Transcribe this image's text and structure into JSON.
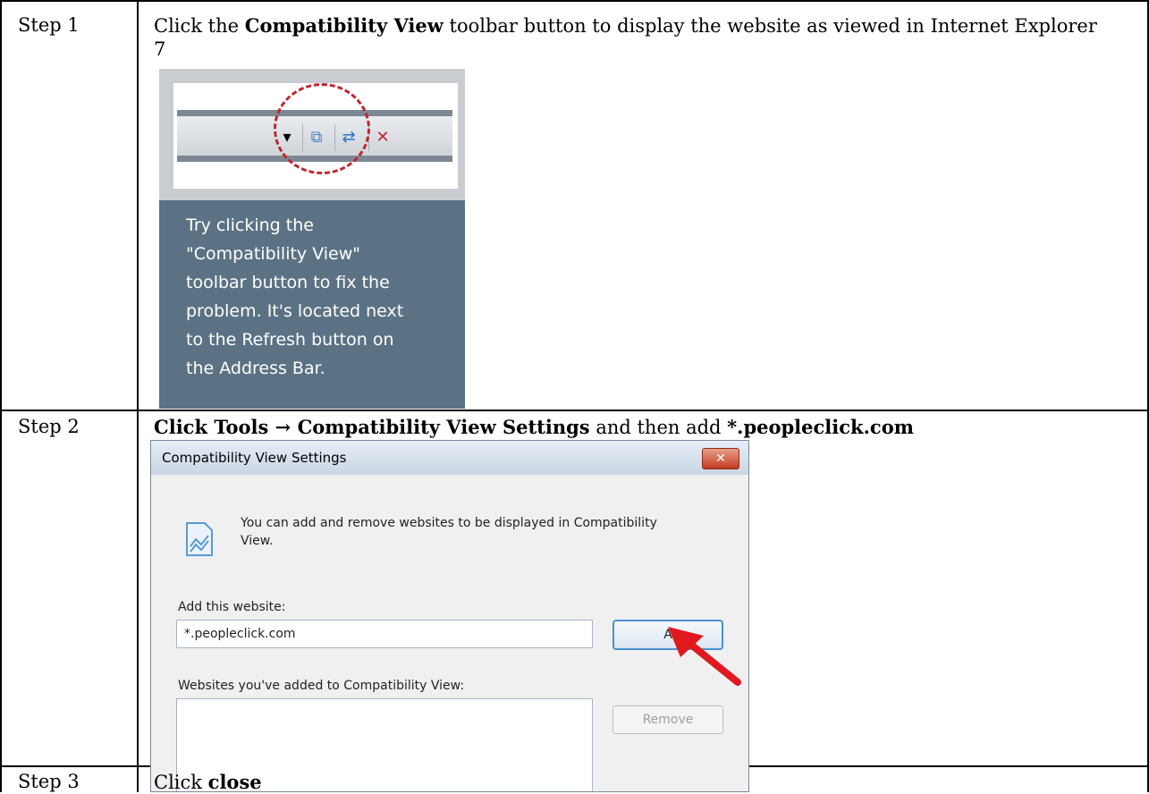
{
  "rows": [
    {
      "label": "Step 1",
      "instr_pre": "Click the ",
      "instr_bold": "Compatibility View",
      "instr_post": " toolbar button to display the website as viewed in Internet Explorer 7"
    },
    {
      "label": "Step 2",
      "instr_bold1": "Click Tools → Compatibility View Settings",
      "instr_mid": " and then add ",
      "instr_bold2": "*.peopleclick.com"
    },
    {
      "label": "Step 3",
      "instr_pre": "Click ",
      "instr_bold": "close"
    }
  ],
  "step1_image": {
    "tip_text": "Try clicking the\n\"Compatibility View\"\ntoolbar button to fix the\nproblem. It's located next\nto the Refresh button on\nthe Address Bar.",
    "icons": [
      "dropdown-arrow-icon",
      "compatibility-view-icon",
      "refresh-icon",
      "stop-icon"
    ],
    "highlight_color": "#c0262d"
  },
  "dialog": {
    "title": "Compatibility View Settings",
    "close_glyph": "✕",
    "description": "You can add and remove websites to be displayed in Compatibility View.",
    "add_label": "Add this website:",
    "add_value": "*.peopleclick.com",
    "add_button": "A",
    "added_label": "Websites you've added to Compatibility View:",
    "remove_button": "Remove",
    "arrow_color": "#e0191e"
  }
}
